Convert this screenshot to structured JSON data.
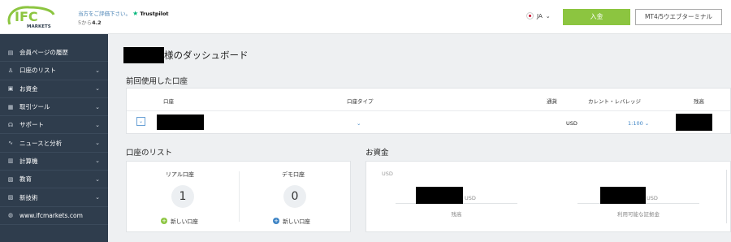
{
  "header": {
    "logo_text": "IFC",
    "logo_sub": "MARKETS",
    "trust_ask": "当方をご評価下さい。",
    "trust_brand": "Trustpilot",
    "trust_rating_prefix": "5から",
    "trust_rating": "4.2",
    "language": "JA",
    "deposit_button": "入金",
    "terminal_button": "MT4/5ウエブターミナル"
  },
  "sidebar": {
    "items": [
      {
        "label": "会員ページの履歴",
        "icon": "document-icon",
        "glyph": "▤",
        "chevron": false
      },
      {
        "label": "口座のリスト",
        "icon": "user-icon",
        "glyph": "♙",
        "chevron": true
      },
      {
        "label": "お資金",
        "icon": "wallet-icon",
        "glyph": "▣",
        "chevron": true
      },
      {
        "label": "取引ツール",
        "icon": "briefcase-icon",
        "glyph": "▦",
        "chevron": true
      },
      {
        "label": "サポート",
        "icon": "headset-icon",
        "glyph": "☊",
        "chevron": true
      },
      {
        "label": "ニュースと分析",
        "icon": "chart-icon",
        "glyph": "∿",
        "chevron": true
      },
      {
        "label": "計算機",
        "icon": "calculator-icon",
        "glyph": "▥",
        "chevron": true
      },
      {
        "label": "教育",
        "icon": "book-icon",
        "glyph": "▧",
        "chevron": true
      },
      {
        "label": "新技術",
        "icon": "chip-icon",
        "glyph": "▨",
        "chevron": true
      },
      {
        "label": "www.ifcmarkets.com",
        "icon": "globe-icon",
        "glyph": "◍",
        "chevron": false
      }
    ]
  },
  "main": {
    "page_title": "様のダッシュボード",
    "recent_title": "前回使用した口座",
    "recent_headers": {
      "account": "口座",
      "type": "口座タイプ",
      "currency": "通貨",
      "leverage": "カレント・レバレッジ",
      "balance": "残高"
    },
    "recent_row": {
      "currency": "USD",
      "leverage": "1:100"
    },
    "accounts_title": "口座のリスト",
    "real_label": "リアル口座",
    "real_count": "1",
    "demo_label": "デモ口座",
    "demo_count": "0",
    "new_account": "新しい口座",
    "funds_title": "お資金",
    "funds_currency": "USD",
    "balance_currency": "USD",
    "balance_caption": "残高",
    "free_margin_currency": "USD",
    "free_margin_caption": "利用可能な証拠金"
  },
  "colors": {
    "sidebar_bg": "#2f3d4d",
    "deposit_green": "#8cc540",
    "plus_green": "#8cc540",
    "plus_blue": "#3b82c4",
    "link_blue": "#3b82c4"
  }
}
